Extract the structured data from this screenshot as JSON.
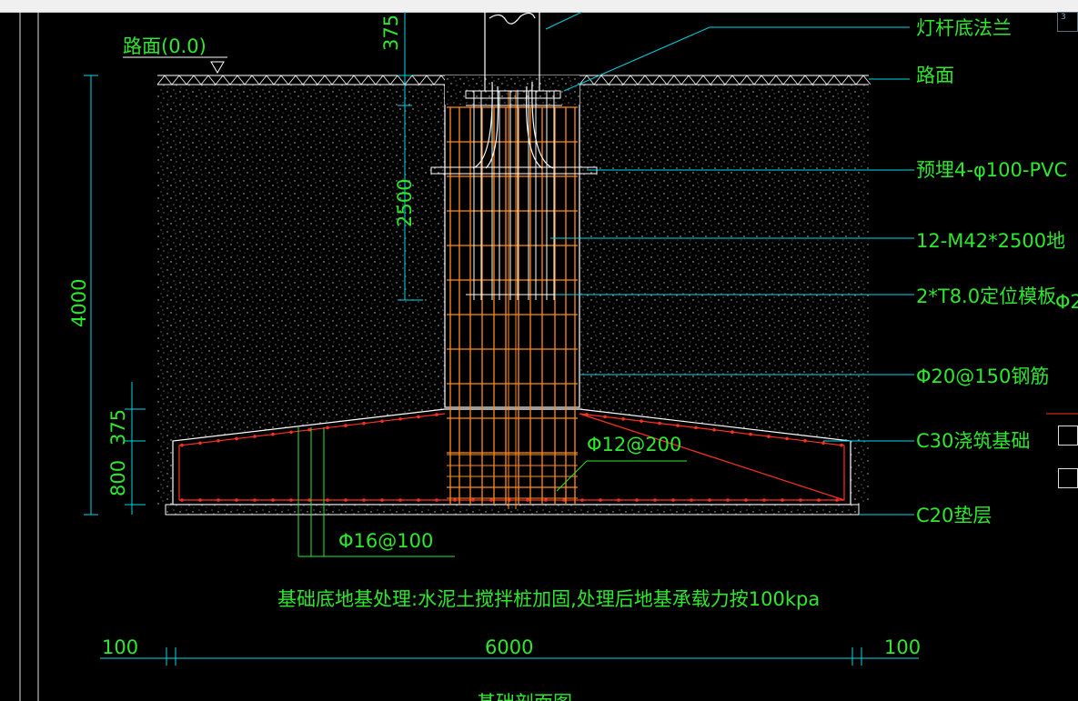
{
  "window": {
    "viewcube_label": "3"
  },
  "labels": {
    "road_level": "路面(0.0)",
    "flange": "灯杆底法兰",
    "road_surface": "路面",
    "pvc": "预埋4-φ100-PVC",
    "bolts": "12-M42*2500地",
    "template": "2*T8.0定位模板",
    "template_cut": "Φ2",
    "rebar_150": "Φ20@150钢筋",
    "c30": "C30浇筑基础",
    "c20": "C20垫层",
    "rebar_200": "Φ12@200",
    "rebar_100": "Φ16@100",
    "note": "基础底地基处理:水泥土搅拌桩加固,处理后地基承载力按100kpa",
    "bottom_title": "基础剖面图"
  },
  "dimensions": {
    "d375_top": "375",
    "d2500": "2500",
    "d4000": "4000",
    "d375_low": "375",
    "d800": "800",
    "d100_left": "100",
    "d6000": "6000",
    "d100_right": "100"
  },
  "colors": {
    "background": "#000000",
    "text": "#2ee82e",
    "leader": "#00d8e8",
    "rebar": "#ff8c1a",
    "outline": "#ffffff",
    "red_rebar": "#ff3020"
  }
}
